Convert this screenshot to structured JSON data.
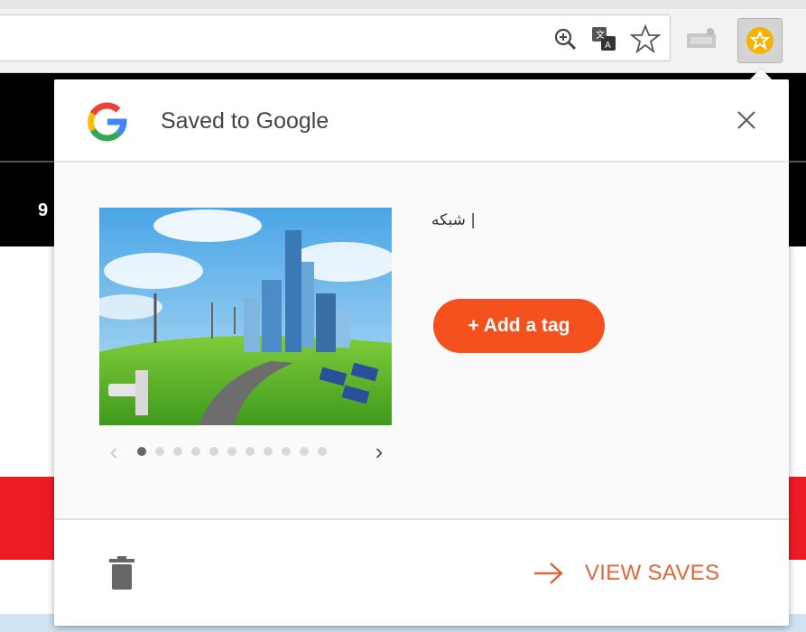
{
  "toolbar": {
    "icons": [
      "zoom-icon",
      "translate-icon",
      "bookmark-star-icon",
      "cast-icon",
      "saves-extension-icon"
    ]
  },
  "page": {
    "partial_number": "9"
  },
  "popup": {
    "title": "Saved to Google",
    "saved_item_title": "| شبکه",
    "add_tag_label": "+ Add a tag",
    "view_saves_label": "VIEW SAVES",
    "pager": {
      "total": 11,
      "current": 1
    },
    "colors": {
      "accent": "#f4511e",
      "link": "#e0653b",
      "page_red": "#ec1c24"
    }
  }
}
